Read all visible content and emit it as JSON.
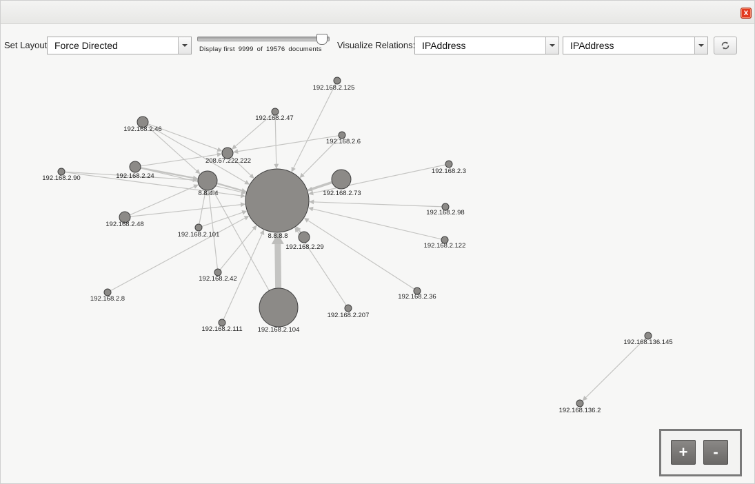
{
  "window": {
    "close_glyph": "x"
  },
  "toolbar": {
    "layout_label": "Set Layout:",
    "layout_selected": "Force Directed",
    "slider": {
      "prefix": "Display first",
      "shown": "9999",
      "of_word": "of",
      "total": "19576",
      "suffix": "documents",
      "fill_fraction": 0.95
    },
    "relations_label": "Visualize Relations:",
    "relation_from": "IPAddress",
    "relation_to": "IPAddress",
    "refresh_icon": "refresh-icon"
  },
  "graph": {
    "node_color": "#8c8a87",
    "edge_color": "#c4c4c2",
    "nodes": [
      {
        "id": "125",
        "label": "192.168.2.125",
        "size": "tiny"
      },
      {
        "id": "47",
        "label": "192.168.2.47",
        "size": "tiny"
      },
      {
        "id": "46",
        "label": "192.168.2.46",
        "size": "small"
      },
      {
        "id": "6",
        "label": "192.168.2.6",
        "size": "tiny"
      },
      {
        "id": "208",
        "label": "208.67.222.222",
        "size": "small"
      },
      {
        "id": "24",
        "label": "192.168.2.24",
        "size": "small"
      },
      {
        "id": "90",
        "label": "192.168.2.90",
        "size": "tiny"
      },
      {
        "id": "8844",
        "label": "8.8.4.4",
        "size": "medium"
      },
      {
        "id": "8888",
        "label": "8.8.8.8",
        "size": "huge"
      },
      {
        "id": "73",
        "label": "192.168.2.73",
        "size": "medium"
      },
      {
        "id": "3",
        "label": "192.168.2.3",
        "size": "tiny"
      },
      {
        "id": "98",
        "label": "192.168.2.98",
        "size": "tiny"
      },
      {
        "id": "48",
        "label": "192.168.2.48",
        "size": "small"
      },
      {
        "id": "101",
        "label": "192.168.2.101",
        "size": "tiny"
      },
      {
        "id": "29",
        "label": "192.168.2.29",
        "size": "small"
      },
      {
        "id": "122",
        "label": "192.168.2.122",
        "size": "tiny"
      },
      {
        "id": "42",
        "label": "192.168.2.42",
        "size": "tiny"
      },
      {
        "id": "36",
        "label": "192.168.2.36",
        "size": "tiny"
      },
      {
        "id": "8",
        "label": "192.168.2.8",
        "size": "tiny"
      },
      {
        "id": "207",
        "label": "192.168.2.207",
        "size": "tiny"
      },
      {
        "id": "111",
        "label": "192.168.2.111",
        "size": "tiny"
      },
      {
        "id": "104",
        "label": "192.168.2.104",
        "size": "large"
      },
      {
        "id": "136145",
        "label": "192.168.136.145",
        "size": "tiny"
      },
      {
        "id": "1362",
        "label": "192.168.136.2",
        "size": "tiny"
      }
    ],
    "edges": [
      {
        "from": "125",
        "to": "8888",
        "weight": 1
      },
      {
        "from": "47",
        "to": "8888",
        "weight": 1
      },
      {
        "from": "47",
        "to": "208",
        "weight": 1
      },
      {
        "from": "46",
        "to": "8844",
        "weight": 1
      },
      {
        "from": "46",
        "to": "208",
        "weight": 1
      },
      {
        "from": "46",
        "to": "8888",
        "weight": 1
      },
      {
        "from": "6",
        "to": "8888",
        "weight": 1
      },
      {
        "from": "6",
        "to": "208",
        "weight": 1
      },
      {
        "from": "208",
        "to": "8888",
        "weight": 1
      },
      {
        "from": "24",
        "to": "8844",
        "weight": 2
      },
      {
        "from": "24",
        "to": "208",
        "weight": 1
      },
      {
        "from": "24",
        "to": "8888",
        "weight": 1
      },
      {
        "from": "90",
        "to": "8844",
        "weight": 1
      },
      {
        "from": "90",
        "to": "8888",
        "weight": 1
      },
      {
        "from": "8844",
        "to": "8888",
        "weight": 2
      },
      {
        "from": "73",
        "to": "8888",
        "weight": 3
      },
      {
        "from": "3",
        "to": "8888",
        "weight": 1
      },
      {
        "from": "98",
        "to": "8888",
        "weight": 1
      },
      {
        "from": "48",
        "to": "8844",
        "weight": 1
      },
      {
        "from": "48",
        "to": "8888",
        "weight": 1
      },
      {
        "from": "101",
        "to": "8844",
        "weight": 1
      },
      {
        "from": "101",
        "to": "8888",
        "weight": 1
      },
      {
        "from": "29",
        "to": "8888",
        "weight": 2
      },
      {
        "from": "122",
        "to": "8888",
        "weight": 1
      },
      {
        "from": "42",
        "to": "8844",
        "weight": 1
      },
      {
        "from": "42",
        "to": "8888",
        "weight": 1
      },
      {
        "from": "36",
        "to": "8888",
        "weight": 1
      },
      {
        "from": "8",
        "to": "8888",
        "weight": 1
      },
      {
        "from": "207",
        "to": "8888",
        "weight": 1
      },
      {
        "from": "111",
        "to": "8888",
        "weight": 1
      },
      {
        "from": "104",
        "to": "8888",
        "weight": 8
      },
      {
        "from": "104",
        "to": "8844",
        "weight": 1
      },
      {
        "from": "136145",
        "to": "1362",
        "weight": 1
      }
    ]
  },
  "zoom": {
    "in_label": "+",
    "out_label": "-"
  }
}
